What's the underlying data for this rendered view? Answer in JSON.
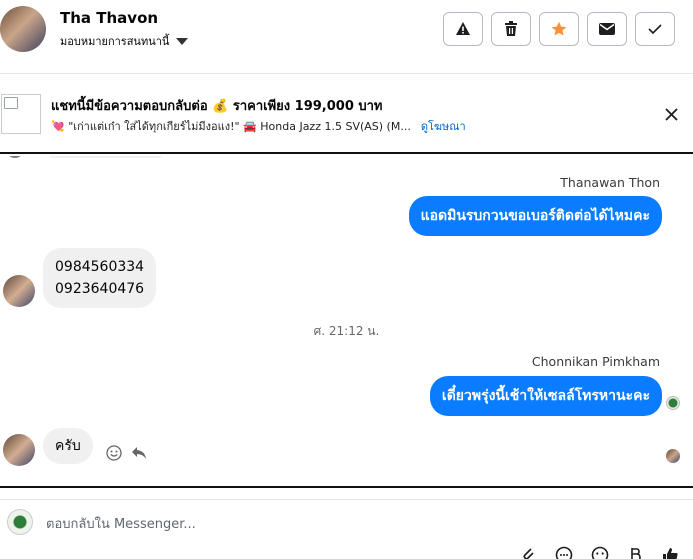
{
  "header": {
    "name": "Tha Thavon",
    "assign_label": "มอบหมายการสนทนานี้",
    "actions": [
      {
        "icon": "warning-icon"
      },
      {
        "icon": "trash-icon"
      },
      {
        "icon": "star-icon",
        "color": "#f7923b"
      },
      {
        "icon": "mail-icon"
      },
      {
        "icon": "check-icon"
      }
    ]
  },
  "ad": {
    "title": "แชทนี้มีข้อความตอบกลับต่อ 💰 ราคาเพียง 199,000 บาท",
    "subtitle": "💘 \"เก่าแต่เก๋า ใส่ได้ทุกเกียร์ไม่มีงอแง!\" 🚘 Honda Jazz 1.5 SV(AS) (M...",
    "link": "ดูโฆษณา"
  },
  "messages": [
    {
      "sender": "Thanawan Thon",
      "text": "แอดมินรบกวนขอเบอร์ติดต่อได้ไหมคะ",
      "direction": "out"
    },
    {
      "text_lines": [
        "0984560334",
        "0923640476"
      ],
      "direction": "in"
    },
    {
      "timestamp": "ศ. 21:12 น."
    },
    {
      "sender": "Chonnikan Pimkham",
      "text": "เดี๋ยวพรุ่งนี้เช้าให้เซลล์โทรหานะคะ",
      "direction": "out"
    },
    {
      "text": "ครับ",
      "direction": "in"
    }
  ],
  "composer": {
    "placeholder": "ตอบกลับใน Messenger..."
  },
  "colors": {
    "outgoing_bubble": "#0a7cff",
    "incoming_bubble": "#f0f0f0",
    "link": "#0064d1"
  }
}
